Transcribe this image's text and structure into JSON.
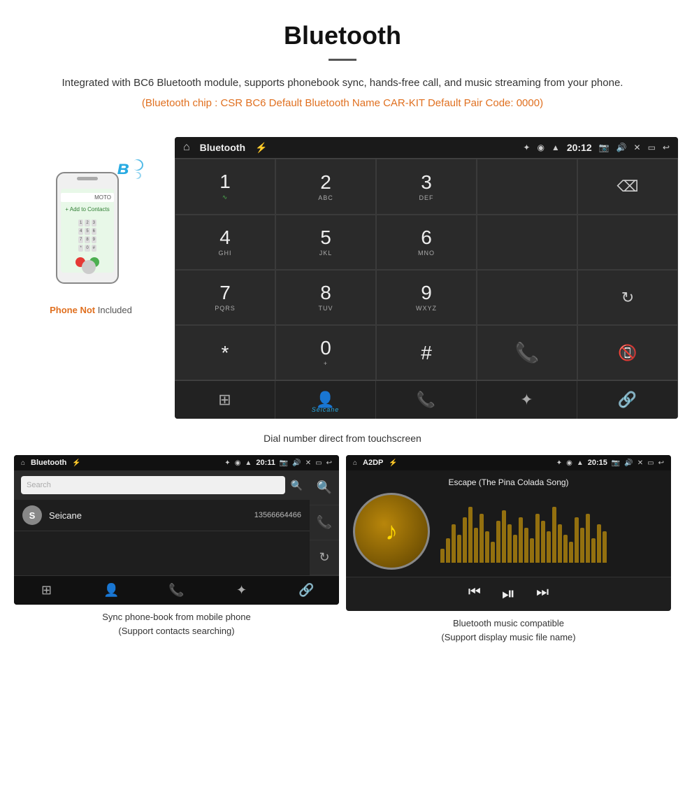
{
  "header": {
    "title": "Bluetooth",
    "subtitle": "Integrated with BC6 Bluetooth module, supports phonebook sync, hands-free call, and music streaming from your phone.",
    "specs": "(Bluetooth chip : CSR BC6    Default Bluetooth Name CAR-KIT    Default Pair Code: 0000)"
  },
  "phone_label": {
    "not": "Phone Not",
    "included": " Included"
  },
  "dialpad_screen": {
    "status_title": "Bluetooth",
    "time": "20:12",
    "keys": [
      {
        "main": "1",
        "sub": ""
      },
      {
        "main": "2",
        "sub": "ABC"
      },
      {
        "main": "3",
        "sub": "DEF"
      },
      {
        "main": "",
        "sub": ""
      },
      {
        "main": "⌫",
        "sub": ""
      },
      {
        "main": "4",
        "sub": "GHI"
      },
      {
        "main": "5",
        "sub": "JKL"
      },
      {
        "main": "6",
        "sub": "MNO"
      },
      {
        "main": "",
        "sub": ""
      },
      {
        "main": "",
        "sub": ""
      },
      {
        "main": "7",
        "sub": "PQRS"
      },
      {
        "main": "8",
        "sub": "TUV"
      },
      {
        "main": "9",
        "sub": "WXYZ"
      },
      {
        "main": "",
        "sub": ""
      },
      {
        "main": "↻",
        "sub": ""
      },
      {
        "main": "*",
        "sub": ""
      },
      {
        "main": "0",
        "sub": "+"
      },
      {
        "main": "#",
        "sub": ""
      },
      {
        "main": "📞",
        "sub": ""
      },
      {
        "main": "📵",
        "sub": ""
      }
    ]
  },
  "dial_caption": "Dial number direct from touchscreen",
  "phonebook": {
    "status_title": "Bluetooth",
    "time": "20:11",
    "search_placeholder": "Search",
    "contacts": [
      {
        "initial": "S",
        "name": "Seicane",
        "number": "13566664466"
      }
    ],
    "caption_line1": "Sync phone-book from mobile phone",
    "caption_line2": "(Support contacts searching)"
  },
  "music": {
    "status_title": "A2DP",
    "time": "20:15",
    "song_title": "Escape (The Pina Colada Song)",
    "caption_line1": "Bluetooth music compatible",
    "caption_line2": "(Support display music file name)"
  },
  "icons": {
    "home": "⌂",
    "usb": "⚡",
    "bluetooth": "✦",
    "location": "◉",
    "wifi": "▲",
    "camera": "📷",
    "volume": "🔊",
    "close_x": "✕",
    "window": "▭",
    "back": "↩",
    "grid": "⊞",
    "person": "👤",
    "phone_call": "📞",
    "bt_symbol": "⚡",
    "link": "🔗",
    "prev": "⏮",
    "play_pause": "⏯",
    "next": "⏭",
    "refresh": "↻"
  },
  "wave_heights": [
    20,
    35,
    55,
    40,
    65,
    80,
    50,
    70,
    45,
    30,
    60,
    75,
    55,
    40,
    65,
    50,
    35,
    70,
    60,
    45,
    80,
    55,
    40,
    30,
    65,
    50,
    70,
    35,
    55,
    45
  ]
}
